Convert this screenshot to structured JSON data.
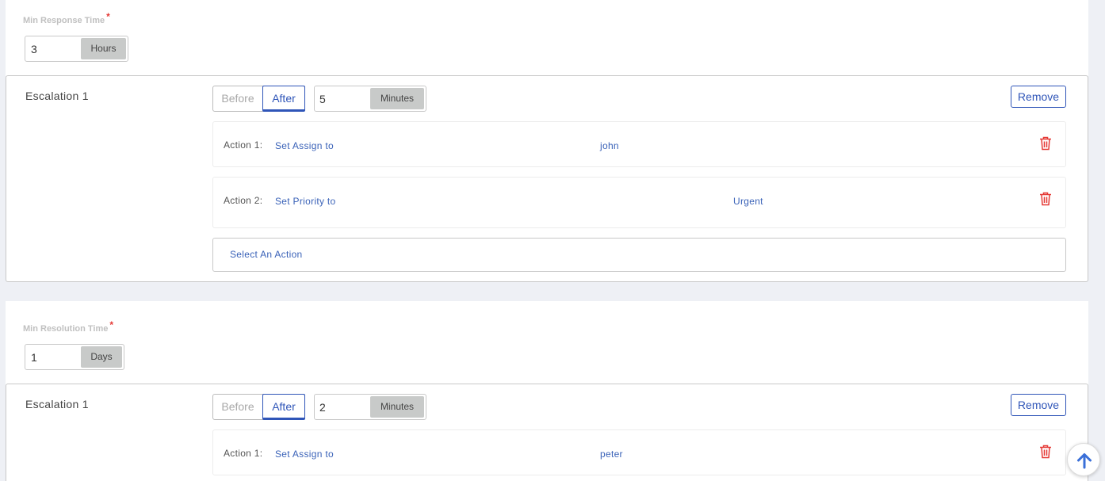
{
  "sections": [
    {
      "label": "Min Response Time",
      "required_mark": "*",
      "value": "3",
      "unit": "Hours",
      "escalation": {
        "title": "Escalation 1",
        "before_label": "Before",
        "after_label": "After",
        "selected": "After",
        "time_value": "5",
        "time_unit": "Minutes",
        "remove_label": "Remove",
        "actions": [
          {
            "label": "Action 1:",
            "action": "Set Assign to",
            "value": "john"
          },
          {
            "label": "Action 2:",
            "action": "Set Priority to",
            "value": "Urgent"
          }
        ],
        "select_action_label": "Select An Action"
      }
    },
    {
      "label": "Min Resolution Time",
      "required_mark": "*",
      "value": "1",
      "unit": "Days",
      "escalation": {
        "title": "Escalation 1",
        "before_label": "Before",
        "after_label": "After",
        "selected": "After",
        "time_value": "2",
        "time_unit": "Minutes",
        "remove_label": "Remove",
        "actions": [
          {
            "label": "Action 1:",
            "action": "Set Assign to",
            "value": "peter"
          }
        ]
      }
    }
  ],
  "colors": {
    "accent": "#2f55b8",
    "link": "#3a62b8",
    "danger": "#e53935",
    "unit_bg": "#c8cac9"
  },
  "icons": {
    "trash": "trash-icon",
    "scroll_top": "arrow-up-icon"
  }
}
